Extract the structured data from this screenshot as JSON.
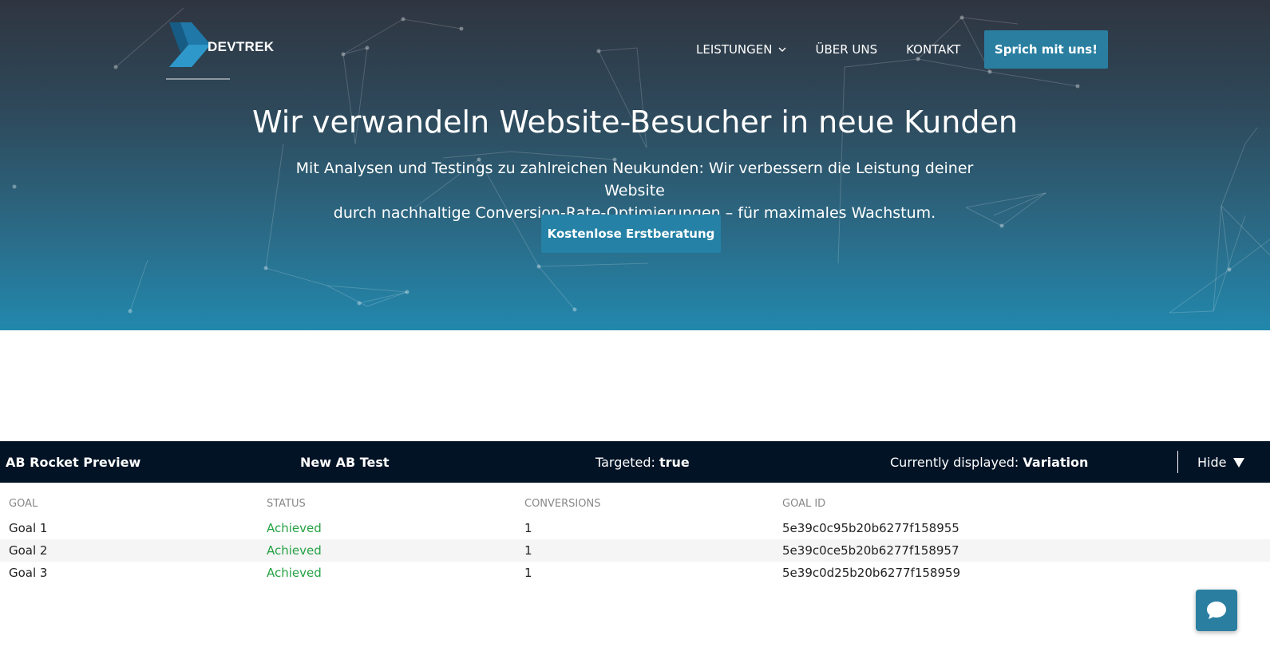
{
  "brand": {
    "name": "DEVTREK"
  },
  "nav": {
    "items": [
      {
        "label": "LEISTUNGEN",
        "has_dropdown": true
      },
      {
        "label": "ÜBER UNS"
      },
      {
        "label": "KONTAKT"
      }
    ],
    "cta": "Sprich mit uns!"
  },
  "hero": {
    "title": "Wir verwandeln Website-Besucher in neue Kunden",
    "subtitle_line1": "Mit Analysen und Testings zu zahlreichen Neukunden: Wir verbessern die Leistung deiner Website",
    "subtitle_line2": "durch nachhaltige Conversion-Rate-Optimierungen – für maximales Wachstum.",
    "cta": "Kostenlose Erstberatung"
  },
  "ab_bar": {
    "title": "AB Rocket Preview",
    "test_name": "New AB Test",
    "targeted_label": "Targeted:",
    "targeted_value": "true",
    "displayed_label": "Currently displayed:",
    "displayed_value": "Variation",
    "hide_label": "Hide"
  },
  "goals": {
    "headers": [
      "GOAL",
      "STATUS",
      "CONVERSIONS",
      "GOAL ID"
    ],
    "rows": [
      {
        "goal": "Goal 1",
        "status": "Achieved",
        "conversions": "1",
        "goal_id": "5e39c0c95b20b6277f158955"
      },
      {
        "goal": "Goal 2",
        "status": "Achieved",
        "conversions": "1",
        "goal_id": "5e39c0ce5b20b6277f158957"
      },
      {
        "goal": "Goal 3",
        "status": "Achieved",
        "conversions": "1",
        "goal_id": "5e39c0d25b20b6277f158959"
      }
    ]
  },
  "colors": {
    "accent": "#2a7fa1",
    "ab_bar_bg": "#021326",
    "achieved": "#25a244"
  },
  "icons": {
    "logo": "chevron-logo-icon",
    "dropdown": "chevron-down-icon",
    "hide": "triangle-down-icon",
    "chat": "chat-bubble-icon"
  }
}
